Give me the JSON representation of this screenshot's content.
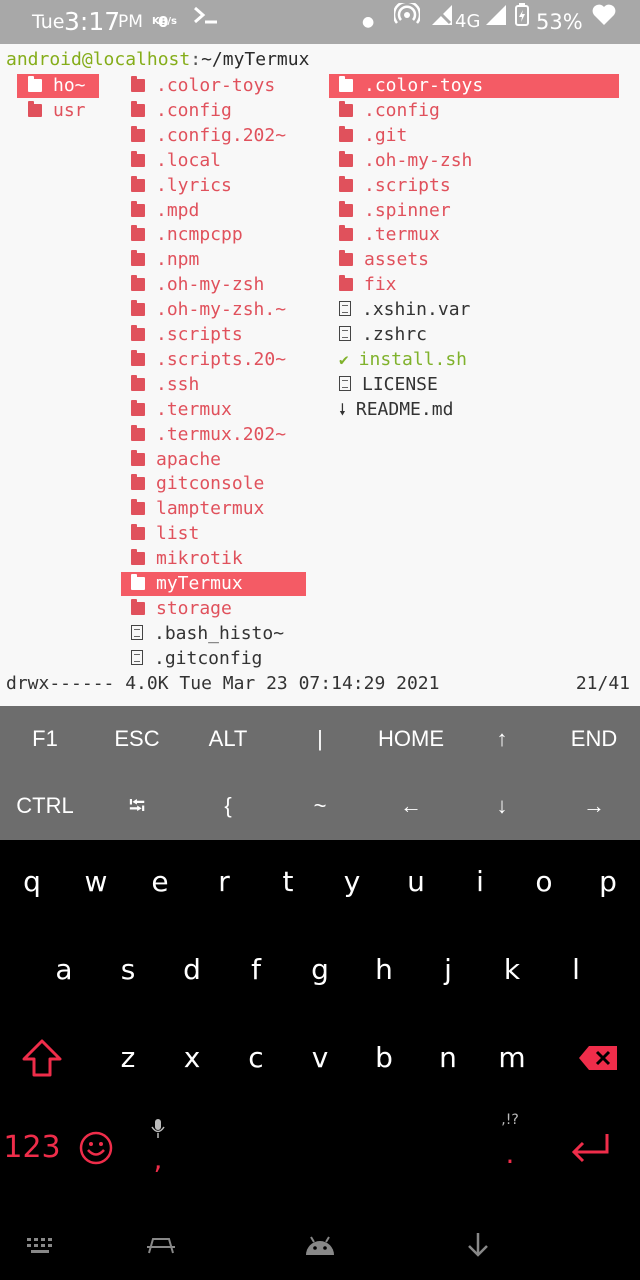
{
  "status_bar": {
    "day": "Tue",
    "time": "3:17",
    "ampm": "PM",
    "speed_value": "0",
    "speed_unit": "KB/s",
    "network": "4G",
    "battery": "53%",
    "icons": [
      "terminal-icon",
      "dot-icon",
      "hotspot-icon",
      "no-data-signal-icon",
      "signal-icon",
      "battery-icon",
      "heart-icon"
    ]
  },
  "terminal": {
    "prompt_user": "android@localhost",
    "prompt_sep": ":",
    "prompt_path": "~/myTermux",
    "left_column": [
      {
        "name": "ho~",
        "type": "dir",
        "selected": true
      },
      {
        "name": "usr",
        "type": "dir",
        "selected": false
      }
    ],
    "middle_column": [
      {
        "name": ".color-toys",
        "type": "dir"
      },
      {
        "name": ".config",
        "type": "dir"
      },
      {
        "name": ".config.202~",
        "type": "dir"
      },
      {
        "name": ".local",
        "type": "dir"
      },
      {
        "name": ".lyrics",
        "type": "dir"
      },
      {
        "name": ".mpd",
        "type": "dir"
      },
      {
        "name": ".ncmpcpp",
        "type": "dir"
      },
      {
        "name": ".npm",
        "type": "dir"
      },
      {
        "name": ".oh-my-zsh",
        "type": "dir"
      },
      {
        "name": ".oh-my-zsh.~",
        "type": "dir"
      },
      {
        "name": ".scripts",
        "type": "dir"
      },
      {
        "name": ".scripts.20~",
        "type": "dir"
      },
      {
        "name": ".ssh",
        "type": "dir"
      },
      {
        "name": ".termux",
        "type": "dir"
      },
      {
        "name": ".termux.202~",
        "type": "dir"
      },
      {
        "name": "apache",
        "type": "dir"
      },
      {
        "name": "gitconsole",
        "type": "dir"
      },
      {
        "name": "lamptermux",
        "type": "dir"
      },
      {
        "name": "list",
        "type": "dir"
      },
      {
        "name": "mikrotik",
        "type": "dir"
      },
      {
        "name": "myTermux",
        "type": "dir",
        "selected": true
      },
      {
        "name": "storage",
        "type": "dir"
      },
      {
        "name": ".bash_histo~",
        "type": "file"
      },
      {
        "name": ".gitconfig",
        "type": "file"
      }
    ],
    "right_column": [
      {
        "name": ".color-toys",
        "type": "dir",
        "selected": true
      },
      {
        "name": ".config",
        "type": "dir"
      },
      {
        "name": ".git",
        "type": "dir"
      },
      {
        "name": ".oh-my-zsh",
        "type": "dir"
      },
      {
        "name": ".scripts",
        "type": "dir"
      },
      {
        "name": ".spinner",
        "type": "dir"
      },
      {
        "name": ".termux",
        "type": "dir"
      },
      {
        "name": "assets",
        "type": "dir"
      },
      {
        "name": "fix",
        "type": "dir"
      },
      {
        "name": ".xshin.var",
        "type": "file"
      },
      {
        "name": ".zshrc",
        "type": "file"
      },
      {
        "name": "install.sh",
        "type": "exec",
        "glyph": "✔"
      },
      {
        "name": "LICENSE",
        "type": "file"
      },
      {
        "name": "README.md",
        "type": "markdown",
        "glyph": "🠗"
      }
    ],
    "status_line": "drwx------ 4.0K Tue Mar 23 07:14:29 2021",
    "position": "21/41"
  },
  "extra_keys": {
    "row1": [
      "F1",
      "ESC",
      "ALT",
      "|",
      "HOME",
      "↑",
      "END"
    ],
    "row2": [
      "CTRL",
      "⭾",
      "{",
      "~",
      "←",
      "↓",
      "→"
    ]
  },
  "keyboard": {
    "row1": [
      "q",
      "w",
      "e",
      "r",
      "t",
      "y",
      "u",
      "i",
      "o",
      "p"
    ],
    "row2": [
      "a",
      "s",
      "d",
      "f",
      "g",
      "h",
      "j",
      "k",
      "l"
    ],
    "row3": [
      "z",
      "x",
      "c",
      "v",
      "b",
      "n",
      "m"
    ],
    "num_key": "123",
    "comma": ",",
    "period": ".",
    "punct_hint": ",!?",
    "accent_color": "#ef2d4a"
  },
  "nav_bar": {
    "icons": [
      "keyboard-icon",
      "clipboard-icon",
      "android-icon",
      "hide-keyboard-icon"
    ]
  }
}
